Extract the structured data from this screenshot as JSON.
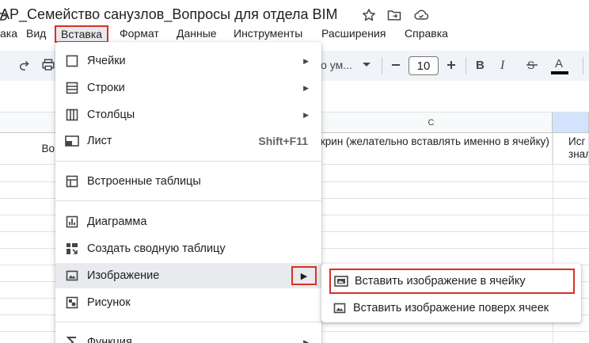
{
  "title": {
    "doc_title": "AP_Семейство санузлов_Вопросы для отдела BIM",
    "icons": [
      "star-icon",
      "move-folder-icon",
      "cloud-status-icon"
    ]
  },
  "menubar": {
    "items": [
      "ака",
      "Вид",
      "Вставка",
      "Формат",
      "Данные",
      "Инструменты",
      "Расширения",
      "Справка"
    ],
    "highlighted": "Вставка"
  },
  "toolbar": {
    "font_name": "о ум...",
    "font_size": "10",
    "icons": [
      "undo-icon",
      "redo-icon",
      "print-icon",
      "font-dropdown-icon",
      "decrease-size-icon",
      "increase-size-icon",
      "bold-icon",
      "italic-icon",
      "strikethrough-icon",
      "text-color-icon"
    ]
  },
  "grid": {
    "column_c_header": "C",
    "cells": {
      "col_b_partial": "Во",
      "col_c": "Скрин (желательно вставлять именно в ячейку)",
      "col_d_line1": "Исг",
      "col_d_line2": "знал"
    }
  },
  "insert_menu": {
    "items": [
      {
        "label": "Ячейки",
        "icon": "cells-icon",
        "submenu": "▶"
      },
      {
        "label": "Строки",
        "icon": "rows-icon",
        "submenu": "▶"
      },
      {
        "label": "Столбцы",
        "icon": "columns-icon",
        "submenu": "▶"
      },
      {
        "label": "Лист",
        "icon": "sheet-icon",
        "shortcut": "Shift+F11"
      },
      {
        "label": "Встроенные таблицы",
        "icon": "table-icon"
      },
      {
        "label": "Диаграмма",
        "icon": "chart-icon"
      },
      {
        "label": "Создать сводную таблицу",
        "icon": "pivot-table-icon"
      },
      {
        "label": "Изображение",
        "icon": "image-icon",
        "submenu": "▶"
      },
      {
        "label": "Рисунок",
        "icon": "drawing-icon"
      },
      {
        "label": "Функция",
        "icon": "function-icon",
        "submenu": "▶"
      }
    ]
  },
  "image_submenu": {
    "items": [
      {
        "label": "Вставить изображение в ячейку",
        "icon": "image-in-cell-icon"
      },
      {
        "label": "Вставить изображение поверх ячеек",
        "icon": "image-over-cells-icon"
      }
    ]
  },
  "colors": {
    "highlight_border": "#d93025",
    "menu_hover": "#e8eaed",
    "toolbar_bg": "#f0f4f9",
    "selected_column": "#d3e3fd"
  }
}
